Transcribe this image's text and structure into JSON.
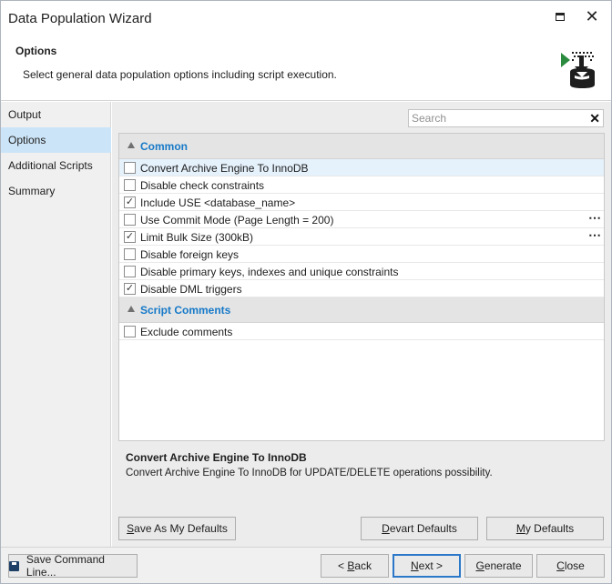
{
  "window": {
    "title": "Data Population Wizard"
  },
  "header": {
    "title": "Options",
    "description": "Select general data population options including script execution."
  },
  "sidebar": {
    "items": [
      {
        "label": "Output"
      },
      {
        "label": "Options"
      },
      {
        "label": "Additional Scripts"
      },
      {
        "label": "Summary"
      }
    ]
  },
  "search": {
    "placeholder": "Search",
    "value": ""
  },
  "groups": [
    {
      "label": "Common",
      "options": [
        {
          "label": "Convert Archive Engine To InnoDB",
          "checked": false
        },
        {
          "label": "Disable check constraints",
          "checked": false
        },
        {
          "label": "Include USE <database_name>",
          "checked": true
        },
        {
          "label": "Use Commit Mode (Page Length = 200)",
          "checked": false
        },
        {
          "label": "Limit Bulk Size (300kB)",
          "checked": true
        },
        {
          "label": "Disable foreign keys",
          "checked": false
        },
        {
          "label": "Disable primary keys, indexes and unique constraints",
          "checked": false
        },
        {
          "label": "Disable DML triggers",
          "checked": true
        }
      ]
    },
    {
      "label": "Script Comments",
      "options": [
        {
          "label": "Exclude comments",
          "checked": false
        }
      ]
    }
  ],
  "ellipsis_glyph": "⋯",
  "check_glyph": "✓",
  "description": {
    "title": "Convert Archive Engine To InnoDB",
    "text": "Convert Archive Engine To InnoDB for UPDATE/DELETE operations possibility."
  },
  "defaults_buttons": {
    "save_as_my_defaults": {
      "pre": "",
      "key": "S",
      "post": "ave As My Defaults"
    },
    "devart_defaults": {
      "pre": "",
      "key": "D",
      "post": "evart Defaults"
    },
    "my_defaults": {
      "pre": "",
      "key": "M",
      "post": "y Defaults"
    }
  },
  "footer": {
    "save_command_line": "Save Command Line...",
    "back": {
      "pre": "< ",
      "key": "B",
      "post": "ack"
    },
    "next": {
      "pre": "",
      "key": "N",
      "post": "ext >"
    },
    "generate": {
      "pre": "",
      "key": "G",
      "post": "enerate"
    },
    "close": {
      "pre": "",
      "key": "C",
      "post": "lose"
    }
  },
  "colors": {
    "accent": "#1679c8",
    "selected_row": "#e5f1fb",
    "sidebar_active": "#cce4f7",
    "icon_green": "#2a8a3e",
    "icon_dark": "#1e1e1e"
  },
  "icons": {
    "title_maximize": "maximize-icon",
    "title_close": "close-icon",
    "header": "database-import-icon",
    "footer_save": "floppy-disk-icon"
  }
}
